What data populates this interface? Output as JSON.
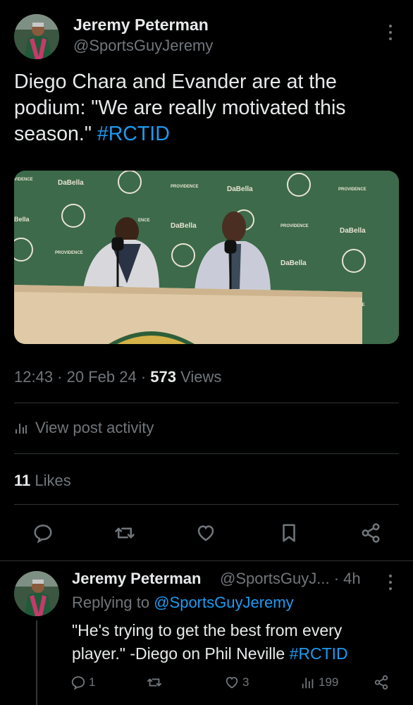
{
  "tweet": {
    "author_name": "Jeremy Peterman",
    "author_handle": "@SportsGuyJeremy",
    "text_plain": "Diego Chara and Evander are at the podium: \"We are really motivated this season.\"",
    "hashtag": "#RCTID",
    "time": "12:43",
    "date": "20 Feb 24",
    "views_count": "573",
    "views_label": "Views",
    "activity_label": "View post activity",
    "likes_count": "11",
    "likes_label": "Likes",
    "media_banner_text": {
      "sponsor1": "DaBella",
      "sponsor2": "PROVIDENCE",
      "left_edge_1": "VIDENCE",
      "left_edge_2": "Bella",
      "mid_ence": "ENCE"
    }
  },
  "actions": {
    "icons": [
      "reply-icon",
      "retweet-icon",
      "like-icon",
      "bookmark-icon",
      "share-icon"
    ]
  },
  "reply": {
    "author_name": "Jeremy Peterman",
    "author_handle": "@SportsGuyJ...",
    "time_ago": "4h",
    "replying_prefix": "Replying to",
    "replying_to": "@SportsGuyJeremy",
    "text_plain": "\"He's trying to get the best from every player.\" -Diego on Phil Neville",
    "hashtag": "#RCTID",
    "reply_count": "1",
    "like_count": "3",
    "views_count": "199"
  },
  "colors": {
    "background": "#000000",
    "text": "#e7e9ea",
    "muted": "#71767b",
    "accent": "#1d9bf0",
    "divider": "#2f3336"
  }
}
